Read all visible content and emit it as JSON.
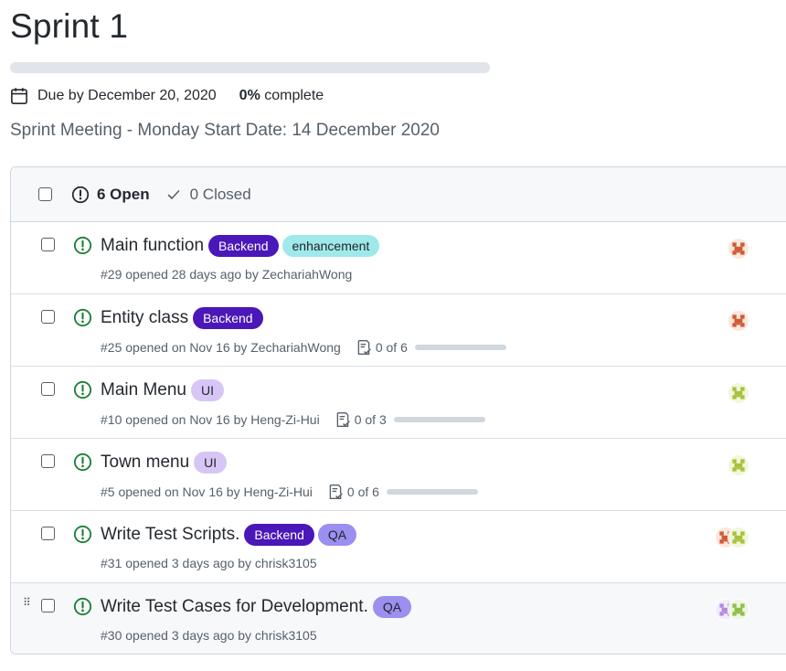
{
  "milestone": {
    "title": "Sprint 1",
    "progress_fraction": 0,
    "due": "Due by December 20, 2020",
    "percent": "0%",
    "complete_label": "complete",
    "description": "Sprint Meeting - Monday Start Date: 14 December 2020"
  },
  "header": {
    "open_label": "6 Open",
    "closed_label": "0 Closed"
  },
  "colors": {
    "backend": "#4a17b8",
    "enhancement": "#9fe9eb",
    "ui": "#d7c6f5",
    "qa": "#9b8ff0",
    "open_green": "#1a7f37"
  },
  "issues": [
    {
      "title": "Main function",
      "labels": [
        "Backend",
        "enhancement"
      ],
      "meta": "#29 opened 28 days ago by ZechariahWong",
      "tasks": "",
      "tasks_fraction": null,
      "avatars": [
        "orange-avatar"
      ]
    },
    {
      "title": "Entity class",
      "labels": [
        "Backend"
      ],
      "meta": "#25 opened on Nov 16 by ZechariahWong",
      "tasks": "0 of 6",
      "tasks_fraction": 0,
      "avatars": [
        "orange-avatar"
      ]
    },
    {
      "title": "Main Menu",
      "labels": [
        "UI"
      ],
      "meta": "#10 opened on Nov 16 by Heng-Zi-Hui",
      "tasks": "0 of 3",
      "tasks_fraction": 0,
      "avatars": [
        "lime-avatar"
      ]
    },
    {
      "title": "Town menu",
      "labels": [
        "UI"
      ],
      "meta": "#5 opened on Nov 16 by Heng-Zi-Hui",
      "tasks": "0 of 6",
      "tasks_fraction": 0,
      "avatars": [
        "lime-avatar"
      ]
    },
    {
      "title": "Write Test Scripts.",
      "labels": [
        "Backend",
        "QA"
      ],
      "meta": "#31 opened 3 days ago by chrisk3105",
      "tasks": "",
      "tasks_fraction": null,
      "avatars": [
        "orange-avatar",
        "lime-avatar"
      ]
    },
    {
      "title": "Write Test Cases for Development.",
      "labels": [
        "QA"
      ],
      "meta": "#30 opened 3 days ago by chrisk3105",
      "tasks": "",
      "tasks_fraction": null,
      "avatars": [
        "purple-avatar",
        "green-avatar"
      ]
    }
  ]
}
